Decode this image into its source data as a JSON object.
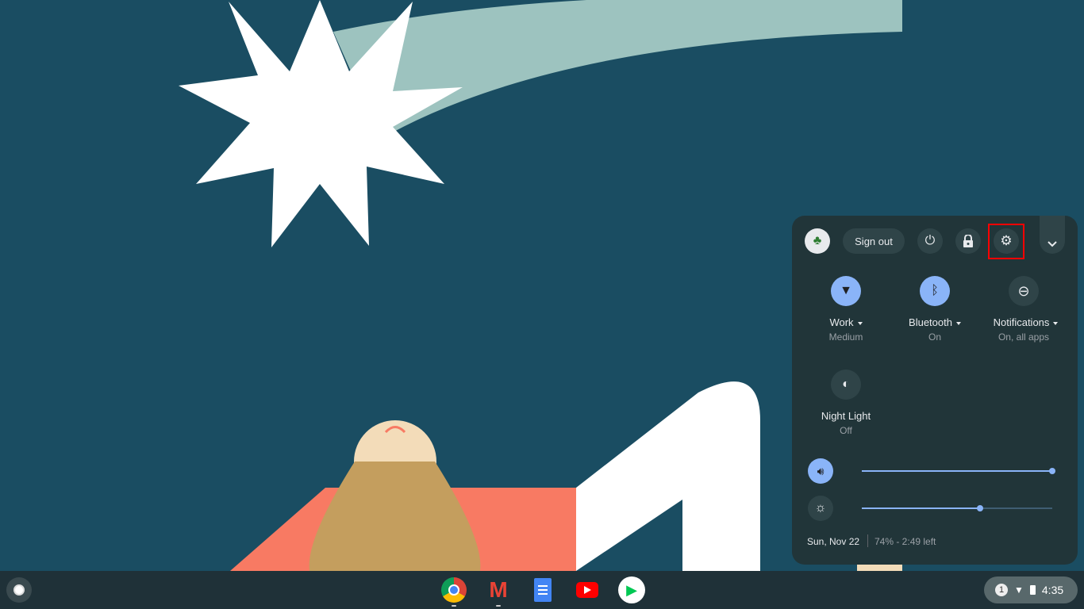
{
  "quick_settings": {
    "sign_out_label": "Sign out",
    "tiles": [
      {
        "label": "Work",
        "sublabel": "Medium",
        "icon": "wifi-lock-icon",
        "active": true
      },
      {
        "label": "Bluetooth",
        "sublabel": "On",
        "icon": "bluetooth-icon",
        "active": true
      },
      {
        "label": "Notifications",
        "sublabel": "On, all apps",
        "icon": "do-not-disturb-icon",
        "active": false
      },
      {
        "label": "Night Light",
        "sublabel": "Off",
        "icon": "night-light-icon",
        "active": false
      }
    ],
    "volume_percent": 100,
    "brightness_percent": 62,
    "date": "Sun, Nov 22",
    "battery": "74% - 2:49 left",
    "accent": "#8ab4f8",
    "highlight": "#ff0000"
  },
  "shelf": {
    "apps": [
      "Chrome",
      "Gmail",
      "Docs",
      "YouTube",
      "Play Store"
    ],
    "status": {
      "notification_count": "1",
      "time": "4:35"
    }
  }
}
